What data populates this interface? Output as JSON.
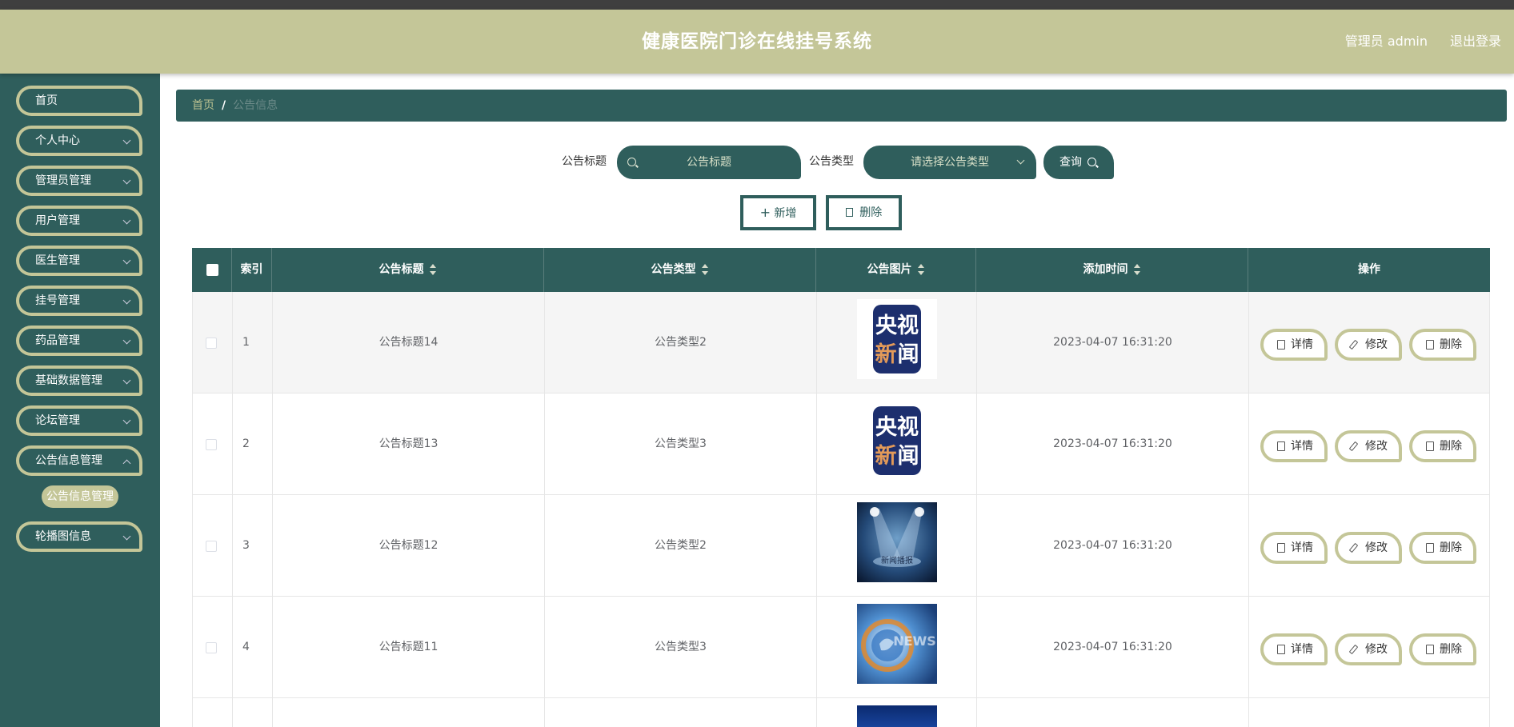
{
  "header": {
    "title": "健康医院门诊在线挂号系统",
    "user": "管理员 admin",
    "logout": "退出登录"
  },
  "sidebar": {
    "items": [
      {
        "label": "首页",
        "has_chevron": false
      },
      {
        "label": "个人中心",
        "has_chevron": true
      },
      {
        "label": "管理员管理",
        "has_chevron": true
      },
      {
        "label": "用户管理",
        "has_chevron": true
      },
      {
        "label": "医生管理",
        "has_chevron": true
      },
      {
        "label": "挂号管理",
        "has_chevron": true
      },
      {
        "label": "药品管理",
        "has_chevron": true
      },
      {
        "label": "基础数据管理",
        "has_chevron": true
      },
      {
        "label": "论坛管理",
        "has_chevron": true
      },
      {
        "label": "公告信息管理",
        "has_chevron": true
      },
      {
        "label": "轮播图信息",
        "has_chevron": true
      }
    ],
    "active_submenu": "公告信息管理"
  },
  "breadcrumb": {
    "home": "首页",
    "separator": "/",
    "current": "公告信息"
  },
  "search": {
    "title_label": "公告标题",
    "title_placeholder": "公告标题",
    "type_label": "公告类型",
    "type_placeholder": "请选择公告类型",
    "query_label": "查询"
  },
  "actions": {
    "add_label": "新增",
    "delete_label": "删除"
  },
  "table": {
    "columns": [
      "索引",
      "公告标题",
      "公告类型",
      "公告图片",
      "添加时间",
      "操作"
    ],
    "rows": [
      {
        "index": "1",
        "title": "公告标题14",
        "type": "公告类型2",
        "image": "cctv-news-logo",
        "time": "2023-04-07 16:31:20"
      },
      {
        "index": "2",
        "title": "公告标题13",
        "type": "公告类型3",
        "image": "cctv-news-logo",
        "time": "2023-04-07 16:31:20"
      },
      {
        "index": "3",
        "title": "公告标题12",
        "type": "公告类型2",
        "image": "news-stage-spotlight",
        "time": "2023-04-07 16:31:20"
      },
      {
        "index": "4",
        "title": "公告标题11",
        "type": "公告类型3",
        "image": "news-globe",
        "time": "2023-04-07 16:31:20"
      }
    ],
    "row_actions": {
      "detail": "详情",
      "edit": "修改",
      "delete": "删除"
    }
  },
  "thumbnails": {
    "cctv_line1": "央视",
    "cctv_line2_a": "新",
    "cctv_line2_b": "闻",
    "stage_text": "新闻播报",
    "globe_text": "NEWS"
  },
  "colors": {
    "primary": "#2f5e5c",
    "accent": "#c4c698",
    "topbar": "#3f3f3f"
  }
}
